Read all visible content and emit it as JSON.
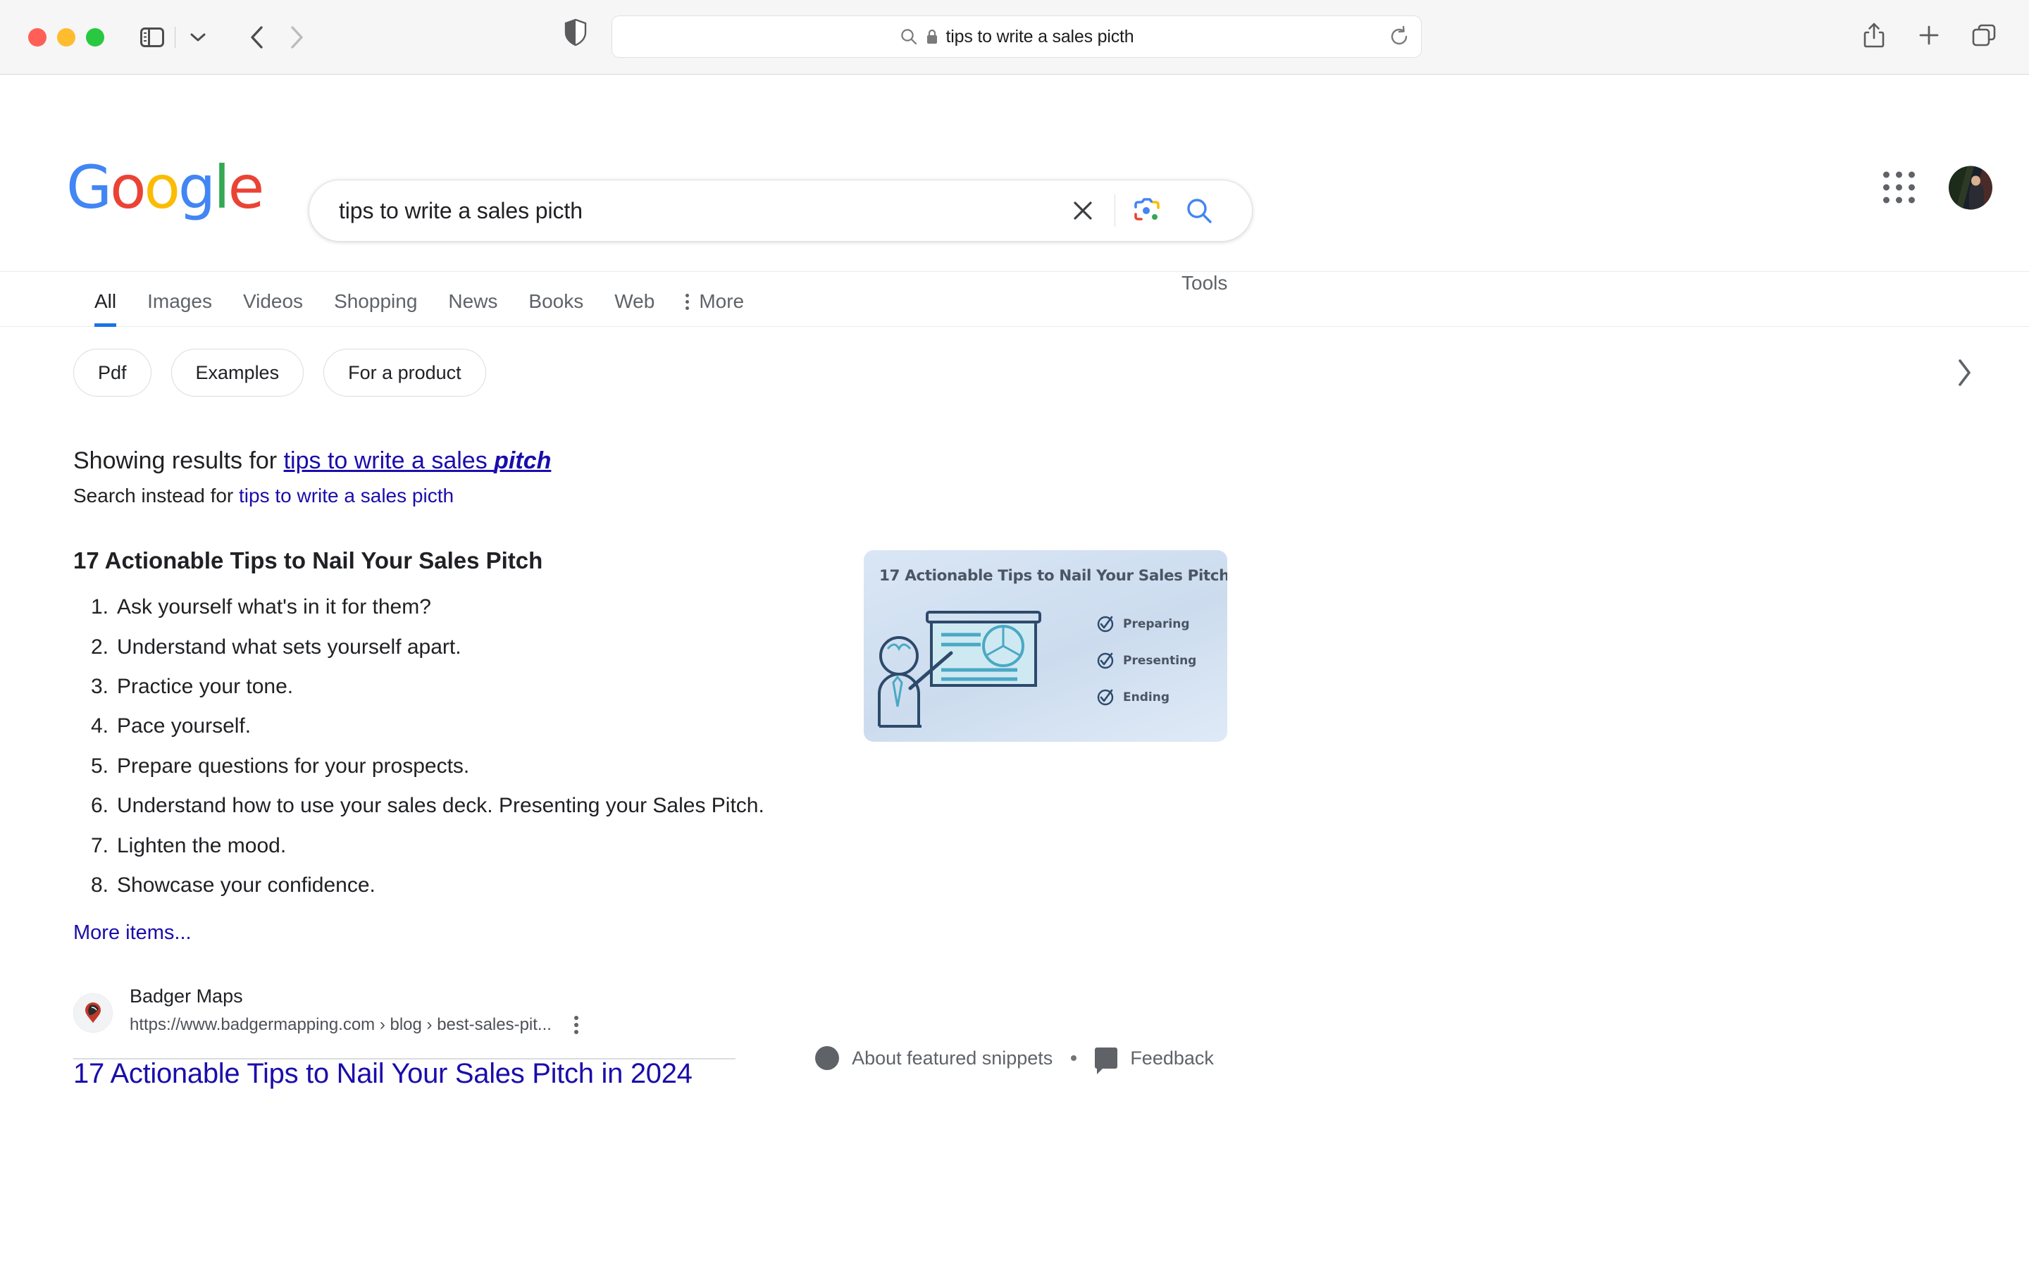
{
  "browser": {
    "url_text": "tips to write a sales picth",
    "icons": {
      "sidebar": "sidebar-icon",
      "sidebar_dropdown": "chevron-down-icon",
      "back": "back-arrow-icon",
      "forward": "forward-arrow-icon",
      "shield": "privacy-shield-icon",
      "search": "search-icon",
      "lock": "lock-icon",
      "reload": "reload-icon",
      "share": "share-icon",
      "new_tab": "plus-icon",
      "tab_overview": "tab-overview-icon"
    }
  },
  "google": {
    "logo_letters": [
      "G",
      "o",
      "o",
      "g",
      "l",
      "e"
    ],
    "search_value": "tips to write a sales picth",
    "clear_label": "clear-icon",
    "lens_label": "google-lens-icon",
    "search_button_label": "search-icon",
    "apps_label": "google-apps-icon",
    "avatar_label": "user-avatar"
  },
  "nav": {
    "tabs": [
      {
        "label": "All",
        "active": true
      },
      {
        "label": "Images",
        "active": false
      },
      {
        "label": "Videos",
        "active": false
      },
      {
        "label": "Shopping",
        "active": false
      },
      {
        "label": "News",
        "active": false
      },
      {
        "label": "Books",
        "active": false
      },
      {
        "label": "Web",
        "active": false
      },
      {
        "label": "More",
        "active": false
      }
    ],
    "tools_label": "Tools"
  },
  "filters": {
    "chips": [
      "Pdf",
      "Examples",
      "For a product"
    ],
    "next_label": "chevron-right-icon"
  },
  "spelling": {
    "showing_prefix": "Showing results for ",
    "showing_query_plain": "tips to write a sales ",
    "showing_query_bold": "pitch",
    "instead_prefix": "Search instead for ",
    "instead_query": "tips to write a sales picth"
  },
  "snippet": {
    "title": "17 Actionable Tips to Nail Your Sales Pitch",
    "items": [
      "Ask yourself what's in it for them?",
      "Understand what sets yourself apart.",
      "Practice your tone.",
      "Pace yourself.",
      "Prepare questions for your prospects.",
      "Understand how to use your sales deck. Presenting your Sales Pitch.",
      "Lighten the mood.",
      "Showcase your confidence."
    ],
    "more_items_label": "More items...",
    "thumbnail": {
      "title": "17 Actionable Tips to Nail Your Sales Pitch",
      "checks": [
        "Preparing",
        "Presenting",
        "Ending"
      ]
    }
  },
  "result": {
    "source_name": "Badger Maps",
    "url": "https://www.badgermapping.com › blog › best-sales-pit...",
    "title": "17 Actionable Tips to Nail Your Sales Pitch in 2024",
    "kebab_label": "more-options-icon"
  },
  "footer": {
    "about_label": "About featured snippets",
    "feedback_label": "Feedback",
    "separator": "•"
  },
  "colors": {
    "link": "#1a0dab",
    "google_blue": "#4285F4",
    "google_red": "#EA4335",
    "google_yellow": "#FBBC05",
    "google_green": "#34A853",
    "active_tab_underline": "#1a73e8"
  }
}
